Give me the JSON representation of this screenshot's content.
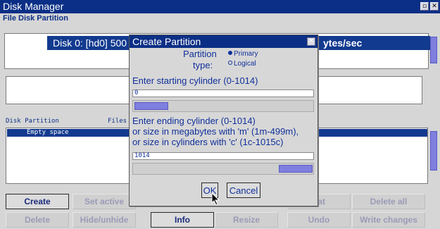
{
  "window": {
    "title": "Disk Manager",
    "menu_label": "File Disk Partition",
    "minimize_glyph": "▫",
    "close_glyph": "✕"
  },
  "disk": {
    "label": "Disk 0: [hd0] 500",
    "speed_text": "ytes/sec",
    "icon": "hard-disk-icon"
  },
  "partition_list": {
    "header_partition": "Disk Partition",
    "header_files": "Files",
    "rows": [
      "Empty space"
    ]
  },
  "buttons": {
    "row1": [
      "Create",
      "Set active",
      "",
      "",
      "nat",
      "Delete all"
    ],
    "row2": [
      "Delete",
      "Hide/unhide",
      "Info",
      "Resize",
      "Undo",
      "Write changes"
    ]
  },
  "dialog": {
    "title": "Create Partition",
    "close_glyph": "✕",
    "partition_type_line1": "Partition",
    "partition_type_line2": "type:",
    "option_primary": "Primary",
    "option_logical": "Logical",
    "start_label": "Enter starting cylinder (0-1014)",
    "start_value": "0",
    "end_label_1": "Enter ending cylinder (0-1014)",
    "end_label_2": "or size in megabytes with 'm' (1m-499m),",
    "end_label_3": "or size in cylinders with 'c' (1c-1015c)",
    "end_value": "1014",
    "ok_label": "OK",
    "cancel_label": "Cancel"
  },
  "colors": {
    "title_bar": "#0b2f86",
    "selection": "#123a8f",
    "accent": "#7f7fe0",
    "text_blue": "#10309a"
  }
}
